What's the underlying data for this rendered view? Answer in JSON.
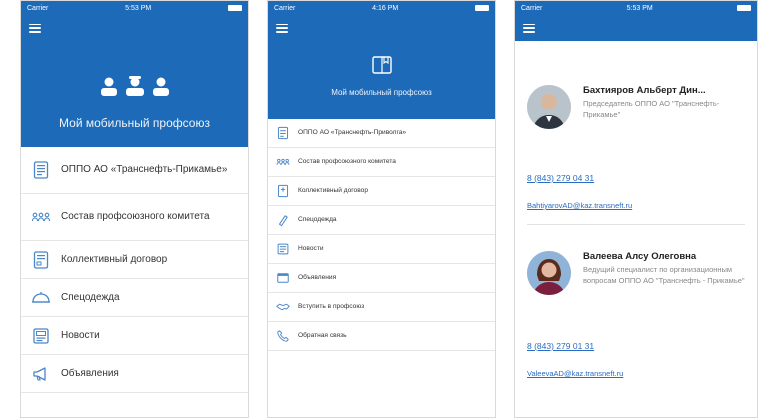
{
  "screens": [
    {
      "status": {
        "carrier": "Carrier",
        "time": "5:53 PM"
      },
      "hero_title": "Мой мобильный профсоюз",
      "menu": [
        {
          "label": "ОППО АО «Транснефть-Прикамье»",
          "icon": "document-icon"
        },
        {
          "label": "Состав профсоюзного комитета",
          "icon": "people-icon"
        },
        {
          "label": "Коллективный договор",
          "icon": "contract-icon"
        },
        {
          "label": "Спецодежда",
          "icon": "workwear-icon"
        },
        {
          "label": "Новости",
          "icon": "news-icon"
        },
        {
          "label": "Объявления",
          "icon": "megaphone-icon"
        }
      ]
    },
    {
      "status": {
        "carrier": "Carrier",
        "time": "4:16 PM"
      },
      "hero_title": "Мой мобильный профсоюз",
      "menu": [
        {
          "label": "ОППО АО «Транснефть-Приволга»",
          "icon": "document-icon"
        },
        {
          "label": "Состав профсоюзного комитета",
          "icon": "people-icon"
        },
        {
          "label": "Коллективный договор",
          "icon": "contract-icon"
        },
        {
          "label": "Спецодежда",
          "icon": "workwear-icon"
        },
        {
          "label": "Новости",
          "icon": "news-icon"
        },
        {
          "label": "Объявления",
          "icon": "board-icon"
        },
        {
          "label": "Вступить в профсоюз",
          "icon": "handshake-icon"
        },
        {
          "label": "Обратная связь",
          "icon": "phone-icon"
        }
      ]
    },
    {
      "status": {
        "carrier": "Carrier",
        "time": "5:53 PM"
      },
      "contacts": [
        {
          "name": "Бахтияров Альберт Дин...",
          "role": "Председатель ОППО АО \"Транснефть- Прикамье\"",
          "phone": "8 (843) 279 04 31",
          "email": "BahtiyarovAD@kaz.transneft.ru"
        },
        {
          "name": "Валеева Алсу Олеговна",
          "role": "Ведущий специалист по организационным вопросам ОППО АО \"Транснефть - Прикамье\"",
          "phone": "8 (843) 279 01 31",
          "email": "ValeevaAD@kaz.transneft.ru"
        }
      ]
    }
  ],
  "colors": {
    "primary": "#1c6ab8",
    "link": "#2a6cc2",
    "icon": "#4a86c9"
  }
}
